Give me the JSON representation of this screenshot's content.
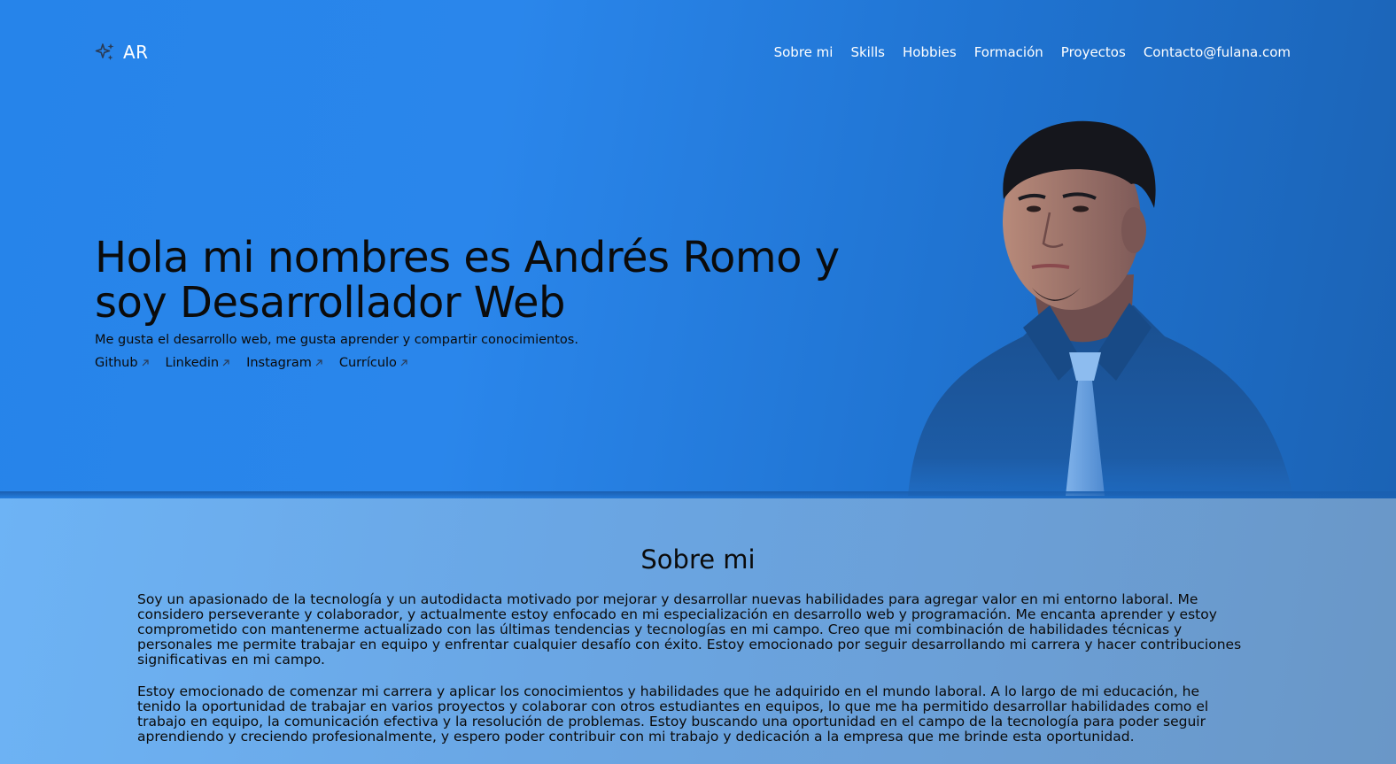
{
  "brand": {
    "text": "AR",
    "icon": "sparkles-icon"
  },
  "nav": {
    "links": [
      "Sobre mi",
      "Skills",
      "Hobbies",
      "Formación",
      "Proyectos",
      "Contacto@fulana.com"
    ]
  },
  "hero": {
    "headline_line1": "Hola mi nombres es Andrés Romo y",
    "headline_line2": "soy Desarrollador Web",
    "tagline": "Me gusta el desarrollo web, me gusta aprender y compartir conocimientos.",
    "social": [
      {
        "label": "Github",
        "icon": "arrow-up-right-icon"
      },
      {
        "label": "Linkedin",
        "icon": "arrow-up-right-icon"
      },
      {
        "label": "Instagram",
        "icon": "arrow-up-right-icon"
      },
      {
        "label": "Currículo",
        "icon": "arrow-up-right-icon"
      }
    ]
  },
  "about": {
    "title": "Sobre mi",
    "paragraph1": "Soy un apasionado de la tecnología y un autodidacta motivado por mejorar y desarrollar nuevas habilidades para agregar valor en mi entorno laboral. Me considero perseverante y colaborador, y actualmente estoy enfocado en mi especialización en desarrollo web y programación. Me encanta aprender y estoy comprometido con mantenerme actualizado con las últimas tendencias y tecnologías en mi campo. Creo que mi combinación de habilidades técnicas y personales me permite trabajar en equipo y enfrentar cualquier desafío con éxito. Estoy emocionado por seguir desarrollando mi carrera y hacer contribuciones significativas en mi campo.",
    "paragraph2": "Estoy emocionado de comenzar mi carrera y aplicar los conocimientos y habilidades que he adquirido en el mundo laboral. A lo largo de mi educación, he tenido la oportunidad de trabajar en varios proyectos y colaborar con otros estudiantes en equipos, lo que me ha permitido desarrollar habilidades como el trabajo en equipo, la comunicación efectiva y la resolución de problemas. Estoy buscando una oportunidad en el campo de la tecnología para poder seguir aprendiendo y creciendo profesionalmente, y espero poder contribuir con mi trabajo y dedicación a la empresa que me brinde esta oportunidad."
  },
  "colors": {
    "hero_bg": "#2684ea",
    "about_bg": "#6aa6e4",
    "text": "#0b0b0b",
    "nav_text": "#ffffff"
  }
}
